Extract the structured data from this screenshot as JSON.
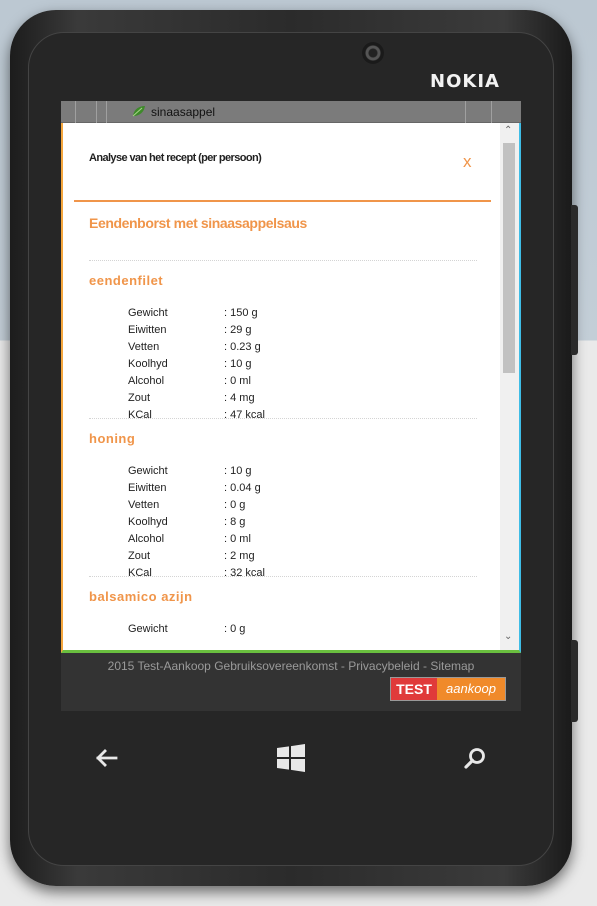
{
  "device": {
    "brand": "NOKIA"
  },
  "tree": {
    "item_label": "sinaasappel"
  },
  "modal": {
    "title": "Analyse van het recept (per persoon)",
    "close_label": "x",
    "recipe_name": "Eendenborst met sinaasappelsaus",
    "ingredients": [
      {
        "name": "eendenfilet",
        "rows": [
          {
            "label": "Gewicht",
            "value": ": 150 g"
          },
          {
            "label": "Eiwitten",
            "value": ": 29 g"
          },
          {
            "label": "Vetten",
            "value": ": 0.23 g"
          },
          {
            "label": "Koolhyd",
            "value": ": 10 g"
          },
          {
            "label": "Alcohol",
            "value": ": 0 ml"
          },
          {
            "label": "Zout",
            "value": ": 4 mg"
          },
          {
            "label": "KCal",
            "value": ": 47 kcal"
          }
        ]
      },
      {
        "name": "honing",
        "rows": [
          {
            "label": "Gewicht",
            "value": ": 10 g"
          },
          {
            "label": "Eiwitten",
            "value": ": 0.04 g"
          },
          {
            "label": "Vetten",
            "value": ": 0 g"
          },
          {
            "label": "Koolhyd",
            "value": ": 8 g"
          },
          {
            "label": "Alcohol",
            "value": ": 0 ml"
          },
          {
            "label": "Zout",
            "value": ": 2 mg"
          },
          {
            "label": "KCal",
            "value": ": 32 kcal"
          }
        ]
      },
      {
        "name": "balsamico azijn",
        "rows": [
          {
            "label": "Gewicht",
            "value": ": 0 g"
          }
        ]
      }
    ]
  },
  "footer": {
    "year_brand": "2015 Test-Aankoop",
    "link_terms": "Gebruiksovereenkomst",
    "sep1": " - ",
    "link_privacy": "Privacybeleid",
    "sep2": " - ",
    "link_sitemap": "Sitemap",
    "logo_left": "TEST",
    "logo_right": "aankoop"
  },
  "navbar": {
    "back_icon": "back-arrow-icon",
    "start_icon": "windows-logo-icon",
    "search_icon": "search-icon"
  },
  "colors": {
    "accent": "#f0954a",
    "logo_red": "#e03a3a",
    "logo_orange": "#f08a2a"
  }
}
